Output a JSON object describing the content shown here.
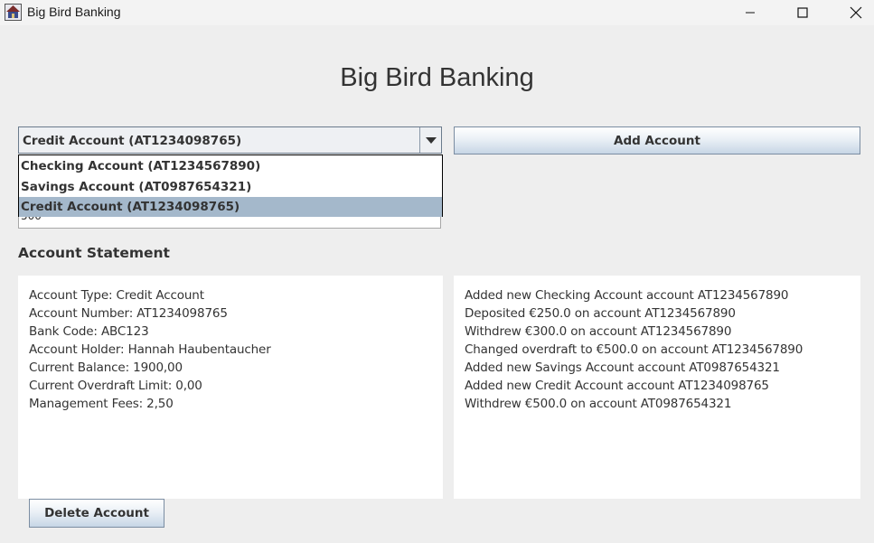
{
  "window": {
    "title": "Big Bird Banking",
    "icon": "app-logo-icon"
  },
  "header": {
    "title": "Big Bird Banking"
  },
  "account_selector": {
    "selected": "Credit Account (AT1234098765)",
    "options": [
      "Checking Account (AT1234567890)",
      "Savings Account (AT0987654321)",
      "Credit Account (AT1234098765)"
    ],
    "highlight_color": "#a4b8cb"
  },
  "add_account": {
    "label": "Add Account"
  },
  "amount_field": {
    "value": "500"
  },
  "statement": {
    "label": "Account Statement",
    "details": [
      "Account Type: Credit Account",
      "Account Number: AT1234098765",
      "Bank Code: ABC123",
      "Account Holder: Hannah Haubentaucher",
      "Current Balance: 1900,00",
      "Current Overdraft Limit: 0,00",
      "Management Fees: 2,50"
    ],
    "log": [
      "Added new Checking Account account AT1234567890",
      "Deposited €250.0 on account AT1234567890",
      "Withdrew €300.0 on account AT1234567890",
      "Changed overdraft to €500.0 on account AT1234567890",
      "Added new Savings Account account AT0987654321",
      "Added new Credit Account account AT1234098765",
      "Withdrew €500.0 on account AT0987654321"
    ]
  },
  "delete_account": {
    "label": "Delete Account"
  }
}
